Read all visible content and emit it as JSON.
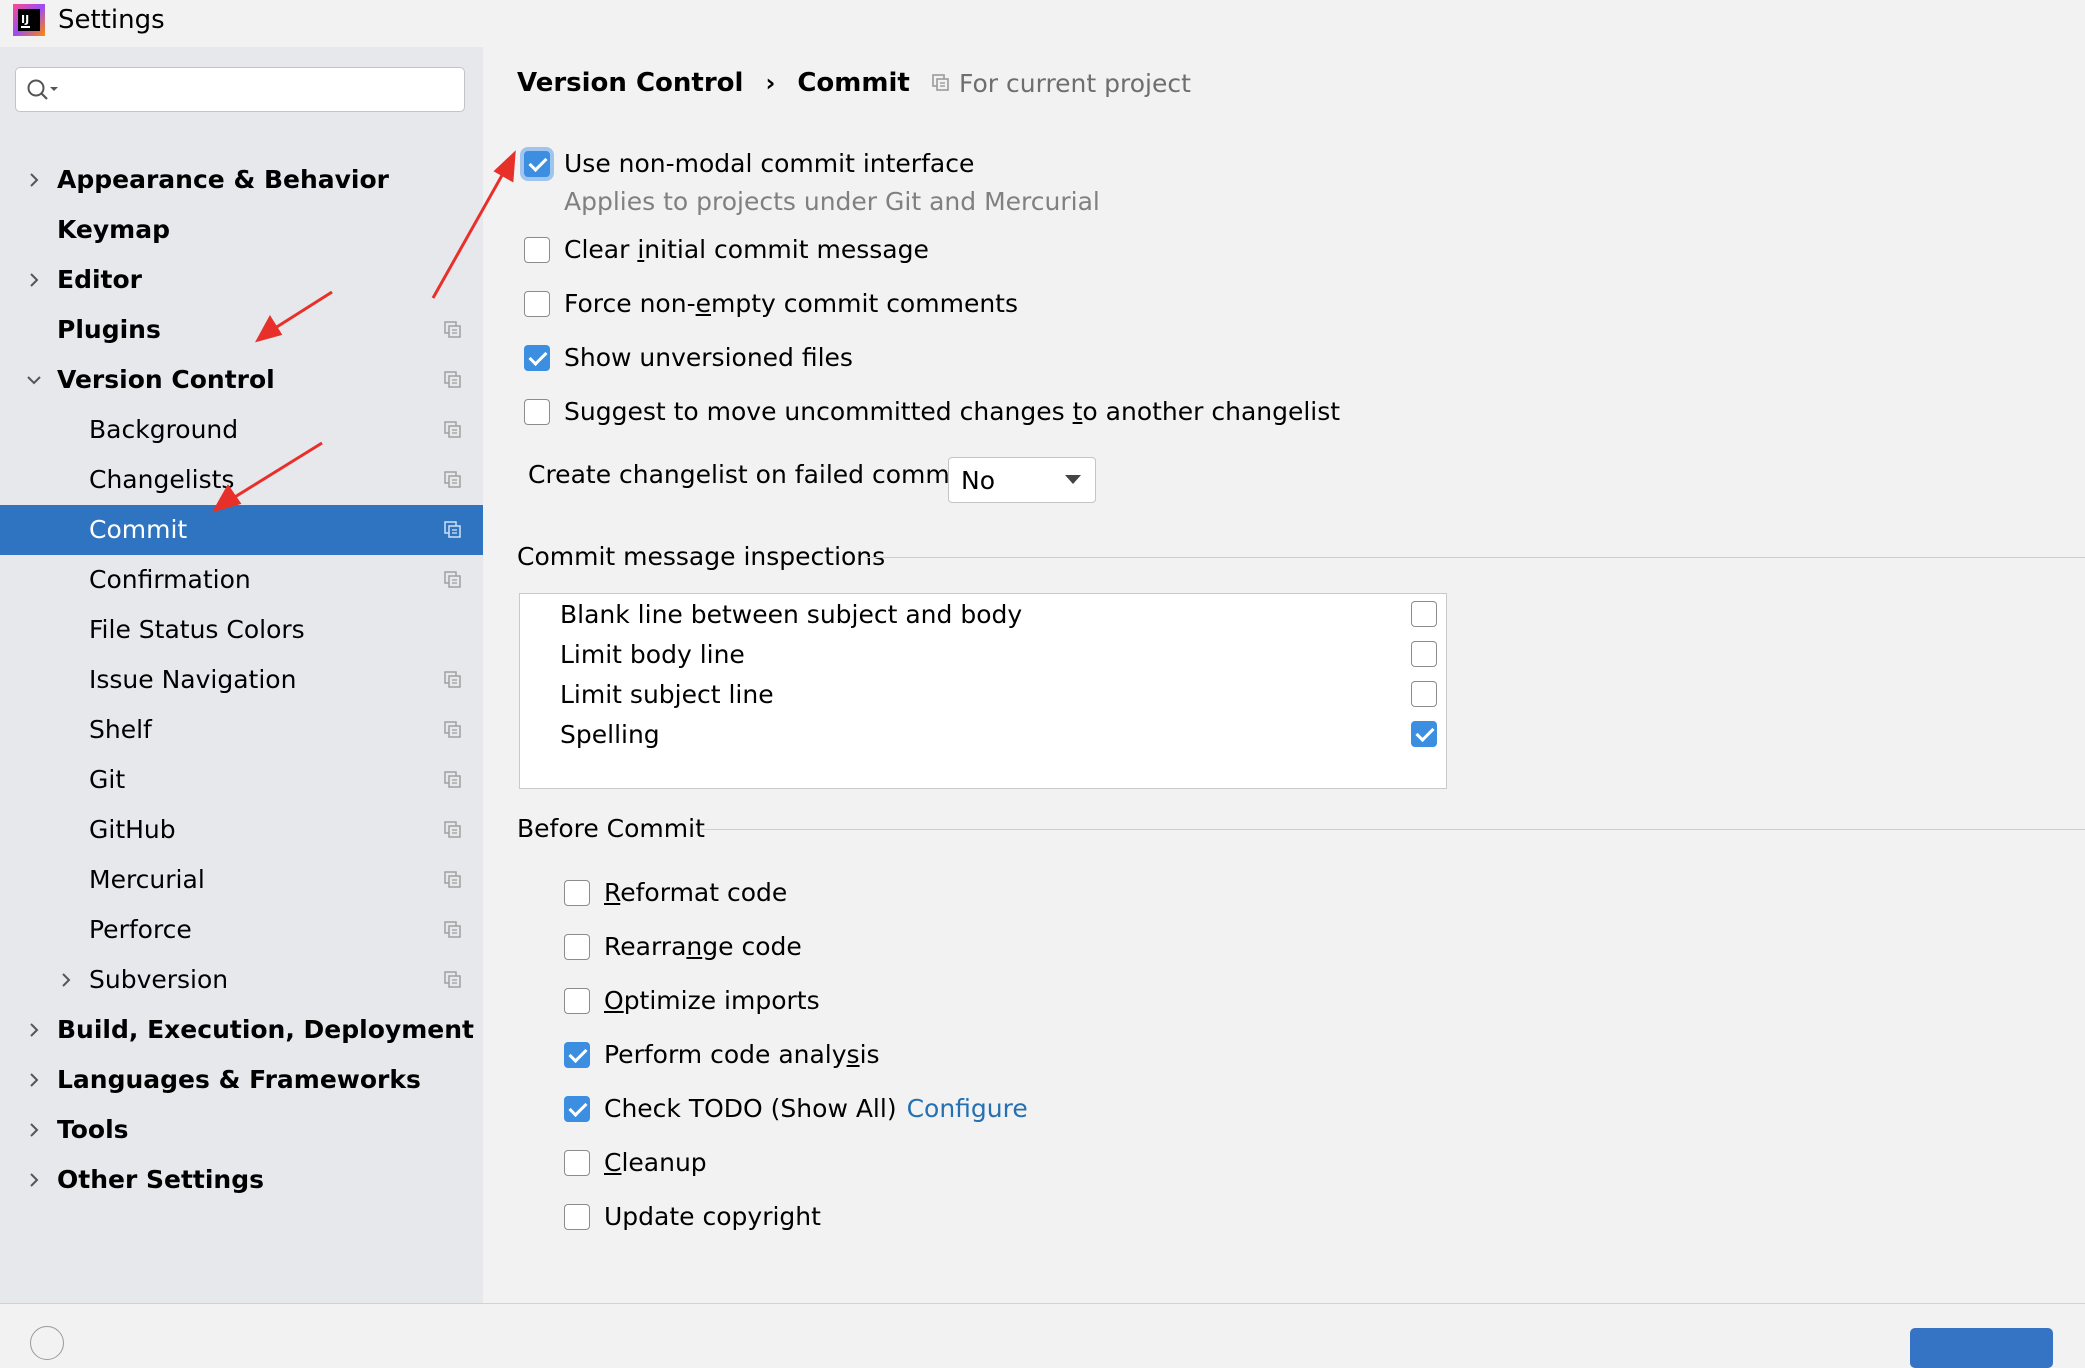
{
  "window": {
    "title": "Settings"
  },
  "search": {
    "value": "",
    "placeholder": ""
  },
  "sidebar": {
    "items": [
      {
        "label": "Appearance & Behavior",
        "level": 0,
        "chevron": "right",
        "project": false,
        "selected": false
      },
      {
        "label": "Keymap",
        "level": 0,
        "chevron": "none",
        "project": false,
        "selected": false
      },
      {
        "label": "Editor",
        "level": 0,
        "chevron": "right",
        "project": false,
        "selected": false
      },
      {
        "label": "Plugins",
        "level": 0,
        "chevron": "none",
        "project": true,
        "selected": false
      },
      {
        "label": "Version Control",
        "level": 0,
        "chevron": "down",
        "project": true,
        "selected": false
      },
      {
        "label": "Background",
        "level": 1,
        "chevron": "none",
        "project": true,
        "selected": false
      },
      {
        "label": "Changelists",
        "level": 1,
        "chevron": "none",
        "project": true,
        "selected": false
      },
      {
        "label": "Commit",
        "level": 1,
        "chevron": "none",
        "project": true,
        "selected": true
      },
      {
        "label": "Confirmation",
        "level": 1,
        "chevron": "none",
        "project": true,
        "selected": false
      },
      {
        "label": "File Status Colors",
        "level": 1,
        "chevron": "none",
        "project": false,
        "selected": false
      },
      {
        "label": "Issue Navigation",
        "level": 1,
        "chevron": "none",
        "project": true,
        "selected": false
      },
      {
        "label": "Shelf",
        "level": 1,
        "chevron": "none",
        "project": true,
        "selected": false
      },
      {
        "label": "Git",
        "level": 1,
        "chevron": "none",
        "project": true,
        "selected": false
      },
      {
        "label": "GitHub",
        "level": 1,
        "chevron": "none",
        "project": true,
        "selected": false
      },
      {
        "label": "Mercurial",
        "level": 1,
        "chevron": "none",
        "project": true,
        "selected": false
      },
      {
        "label": "Perforce",
        "level": 1,
        "chevron": "none",
        "project": true,
        "selected": false
      },
      {
        "label": "Subversion",
        "level": 1,
        "chevron": "right",
        "project": true,
        "selected": false
      },
      {
        "label": "Build, Execution, Deployment",
        "level": 0,
        "chevron": "right",
        "project": false,
        "selected": false
      },
      {
        "label": "Languages & Frameworks",
        "level": 0,
        "chevron": "right",
        "project": false,
        "selected": false
      },
      {
        "label": "Tools",
        "level": 0,
        "chevron": "right",
        "project": false,
        "selected": false
      },
      {
        "label": "Other Settings",
        "level": 0,
        "chevron": "right",
        "project": false,
        "selected": false
      }
    ]
  },
  "breadcrumb": {
    "parent": "Version Control",
    "separator": "›",
    "current": "Commit"
  },
  "scope": {
    "label": "For current project"
  },
  "options": {
    "non_modal": {
      "label": "Use non-modal commit interface",
      "checked": true,
      "hint": "Applies to projects under Git and Mercurial"
    },
    "clear_initial": {
      "pre": "Clear ",
      "mnemonic": "i",
      "post": "nitial commit message",
      "checked": false
    },
    "force_nonempty": {
      "pre": "Force non-",
      "mnemonic": "e",
      "post": "mpty commit comments",
      "checked": false
    },
    "show_unversioned": {
      "label": "Show unversioned files",
      "checked": true
    },
    "suggest_move": {
      "pre": "Suggest to move uncommitted changes ",
      "mnemonic": "t",
      "post": "o another changelist",
      "checked": false
    }
  },
  "changelist_on_fail": {
    "label": "Create changelist on failed commit:",
    "value": "No"
  },
  "inspections": {
    "title": "Commit message inspections",
    "rows": [
      {
        "label": "Blank line between subject and body",
        "checked": false
      },
      {
        "label": "Limit body line",
        "checked": false
      },
      {
        "label": "Limit subject line",
        "checked": false
      },
      {
        "label": "Spelling",
        "checked": true
      }
    ]
  },
  "before_commit": {
    "title": "Before Commit",
    "reformat": {
      "mnemonic": "R",
      "post": "eformat code",
      "checked": false
    },
    "rearrange": {
      "pre": "Rearra",
      "mnemonic": "n",
      "post": "ge code",
      "checked": false
    },
    "optimize": {
      "mnemonic": "O",
      "post": "ptimize imports",
      "checked": false
    },
    "analysis": {
      "pre": "Perform code analy",
      "mnemonic": "s",
      "post": "is",
      "checked": true
    },
    "todo": {
      "label": "Check TODO (Show All)",
      "link": "Configure",
      "checked": true
    },
    "cleanup": {
      "mnemonic": "C",
      "post": "leanup",
      "checked": false
    },
    "copyright": {
      "label": "Update copyright",
      "checked": false
    }
  },
  "colors": {
    "accent": "#2f74c0",
    "checkbox": "#3c8ee0",
    "link": "#2470b3",
    "arrow": "#e8302a"
  }
}
